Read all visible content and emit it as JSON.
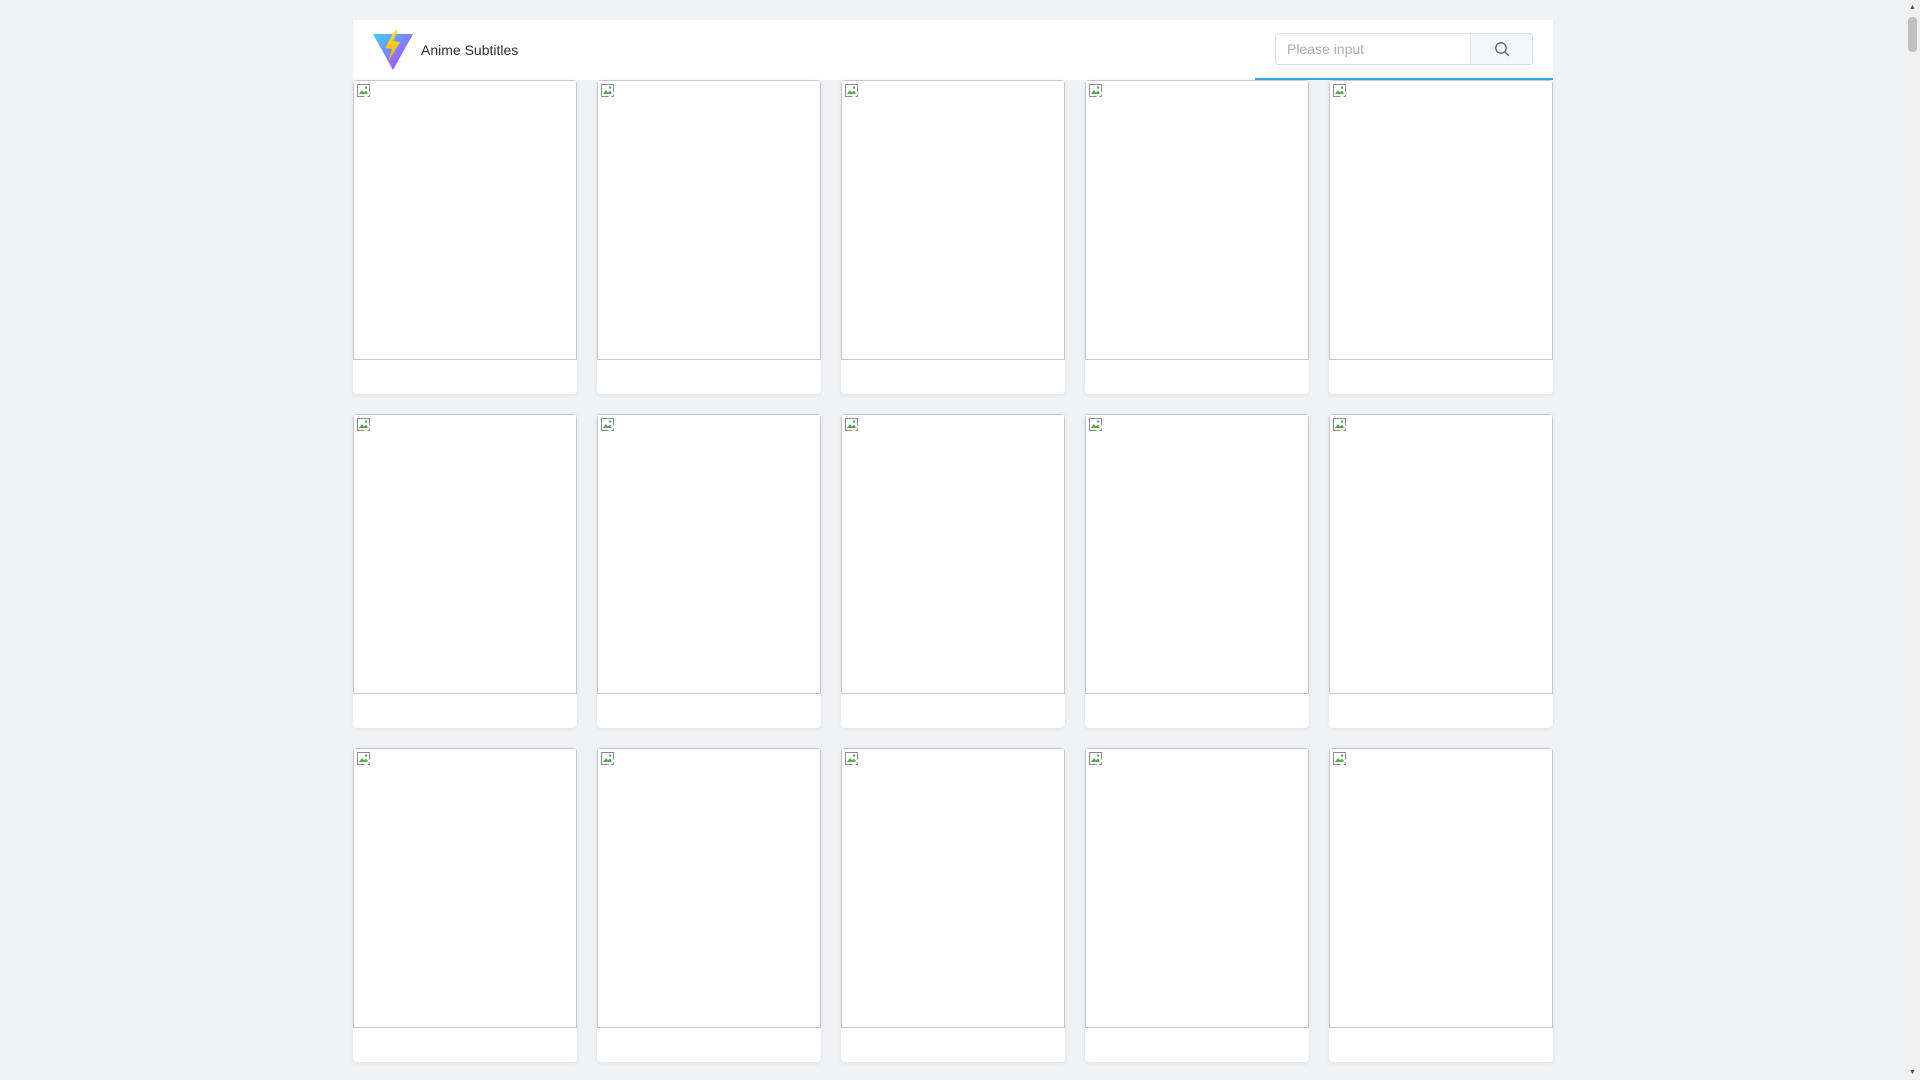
{
  "app": {
    "brand": "Anime Subtitles",
    "logo_icon": "vite-logo-icon"
  },
  "search": {
    "placeholder": "Please input",
    "value": "",
    "button_icon": "search-icon",
    "accent_color": "#409eff"
  },
  "cards": [
    {
      "title": "",
      "image_icon": "broken-image-icon"
    },
    {
      "title": "",
      "image_icon": "broken-image-icon"
    },
    {
      "title": "",
      "image_icon": "broken-image-icon"
    },
    {
      "title": "",
      "image_icon": "broken-image-icon"
    },
    {
      "title": "",
      "image_icon": "broken-image-icon"
    },
    {
      "title": "",
      "image_icon": "broken-image-icon"
    },
    {
      "title": "",
      "image_icon": "broken-image-icon"
    },
    {
      "title": "",
      "image_icon": "broken-image-icon"
    },
    {
      "title": "",
      "image_icon": "broken-image-icon"
    },
    {
      "title": "",
      "image_icon": "broken-image-icon"
    },
    {
      "title": "",
      "image_icon": "broken-image-icon"
    },
    {
      "title": "",
      "image_icon": "broken-image-icon"
    },
    {
      "title": "",
      "image_icon": "broken-image-icon"
    },
    {
      "title": "",
      "image_icon": "broken-image-icon"
    },
    {
      "title": "",
      "image_icon": "broken-image-icon"
    }
  ]
}
